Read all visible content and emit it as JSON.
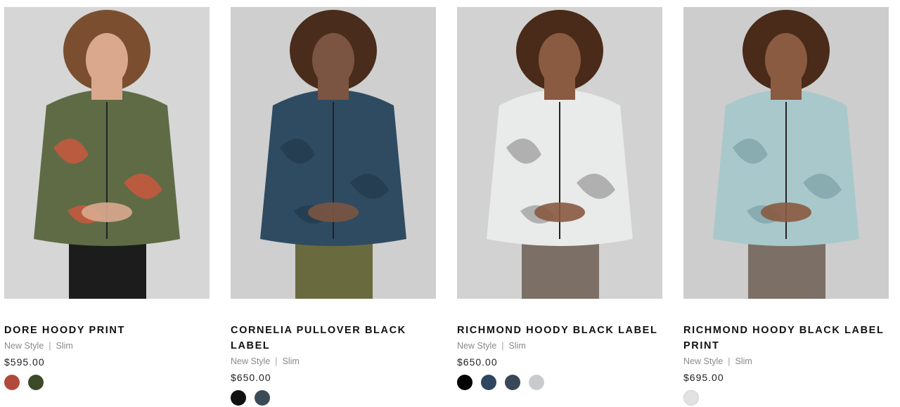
{
  "products": [
    {
      "name": "DORE HOODY PRINT",
      "tag": "New Style",
      "fit": "Slim",
      "price": "$595.00",
      "swatches": [
        "#b24a3c",
        "#3c4a2a"
      ],
      "photo": {
        "bg": "#d6d6d6",
        "jacket": "#5f6b45",
        "accent": "#d8553f",
        "pants": "#1c1c1c",
        "skin": "#d9a88d",
        "hair": "#7a4e2f"
      }
    },
    {
      "name": "CORNELIA PULLOVER BLACK LABEL",
      "tag": "New Style",
      "fit": "Slim",
      "price": "$650.00",
      "swatches": [
        "#111111",
        "#3d4b57"
      ],
      "photo": {
        "bg": "#cfcfcf",
        "jacket": "#2f4b62",
        "accent": "#233a4d",
        "pants": "#6a6a3f",
        "skin": "#7b5541",
        "hair": "#4a2c1c"
      }
    },
    {
      "name": "RICHMOND HOODY BLACK LABEL",
      "tag": "New Style",
      "fit": "Slim",
      "price": "$650.00",
      "swatches": [
        "#000000",
        "#2e4660",
        "#3a4756",
        "#c7cbcd"
      ],
      "photo": {
        "bg": "#d2d2d2",
        "jacket": "#e9eaea",
        "accent": "#9c9c9c",
        "pants": "#7b6f66",
        "skin": "#8a5a41",
        "hair": "#4a2a18"
      }
    },
    {
      "name": "RICHMOND HOODY BLACK LABEL PRINT",
      "tag": "New Style",
      "fit": "Slim",
      "price": "$695.00",
      "swatches": [
        "#e2e2e2"
      ],
      "photo": {
        "bg": "#cdcdcd",
        "jacket": "#a9c8cb",
        "accent": "#7fa3a8",
        "pants": "#7b6f66",
        "skin": "#8a5a41",
        "hair": "#4a2a18"
      }
    }
  ]
}
